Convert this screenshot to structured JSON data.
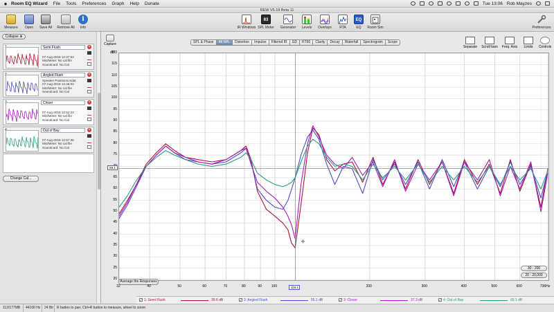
{
  "menubar": {
    "apple": "",
    "app_name": "Room EQ Wizard",
    "items": [
      "File",
      "Tools",
      "Preferences",
      "Graph",
      "Help",
      "Donate"
    ],
    "clock": "Tue 13:06",
    "user": "Rob Mayzes"
  },
  "window": {
    "title": "REW V5.19 Beta 11"
  },
  "toolbar": {
    "left": [
      {
        "label": "Measure",
        "color": "#e8c24a"
      },
      {
        "label": "Open",
        "color": "#6b86c9"
      },
      {
        "label": "Save All",
        "color": "#8a8a8a"
      },
      {
        "label": "Remove All",
        "color": "#c95050"
      },
      {
        "label": "Info",
        "color": "#3a78c9"
      }
    ],
    "center": [
      {
        "label": "IR Windows"
      },
      {
        "label": "SPL Meter",
        "badge": "83"
      },
      {
        "label": "Generator"
      },
      {
        "label": "Levels"
      },
      {
        "label": "Overlays"
      },
      {
        "label": "RTA"
      },
      {
        "label": "EQ"
      },
      {
        "label": "Room Sim"
      }
    ],
    "right": [
      {
        "label": "Preferences"
      }
    ]
  },
  "left_panel": {
    "collapse_label": "Collapse",
    "change_cal_label": "Change Cal...",
    "measurements": [
      {
        "num": "1",
        "name": "Semi Flush",
        "date": "07-Aug-2018 12:37:53",
        "mic": "Mic/Meter: No cal file",
        "soundcard": "Soundcard: No Cal",
        "color": "#b0142b"
      },
      {
        "num": "2",
        "name": "Angled Flush",
        "file": "Speaker Positions.mdat",
        "date": "07-Aug-2018 12:46:03",
        "mic": "Mic/Meter: No cal file",
        "soundcard": "Soundcard: No Cal",
        "color": "#4b4bc4"
      },
      {
        "num": "3",
        "name": "Closer",
        "date": "07-Aug-2018 12:52:23",
        "mic": "Mic/Meter: No cal file",
        "soundcard": "Soundcard: No Cal",
        "color": "#a51ac0"
      },
      {
        "num": "4",
        "name": "Out of Bay",
        "date": "07-Aug-2018 12:57:38",
        "mic": "Mic/Meter: No cal file",
        "soundcard": "Soundcard: No Cal",
        "color": "#2a9a84"
      }
    ]
  },
  "graph_panel": {
    "capture_label": "Capture",
    "tabs": [
      "SPL & Phase",
      "All SPL",
      "Distortion",
      "Impulse",
      "Filtered IR",
      "GD",
      "RT60",
      "Clarity",
      "Decay",
      "Waterfall",
      "Spectrogram",
      "Scope"
    ],
    "active_tab": "All SPL",
    "tools": [
      "Separate",
      "Scroll bars",
      "Freq. Axis",
      "Limits",
      "Controls"
    ],
    "avg_label": "Average the Responses",
    "range_buttons": [
      "30 - 200",
      "20 - 20,000"
    ],
    "cursor_level_label": "69.1",
    "cursor_freq_label": "116.1"
  },
  "chart_data": {
    "type": "line",
    "xscale": "log",
    "xlim": [
      32,
      736
    ],
    "ylim": [
      20,
      120
    ],
    "ylabel": "dB",
    "yticks": [
      120,
      115,
      110,
      105,
      100,
      95,
      90,
      85,
      80,
      75,
      70,
      65,
      60,
      55,
      50,
      45,
      40,
      35,
      30,
      25,
      20
    ],
    "xticks": [
      {
        "value": 32,
        "label": "32"
      },
      {
        "value": 40,
        "label": "40"
      },
      {
        "value": 50,
        "label": "50"
      },
      {
        "value": 60,
        "label": "60"
      },
      {
        "value": 70,
        "label": "70"
      },
      {
        "value": 80,
        "label": "80"
      },
      {
        "value": 90,
        "label": "90"
      },
      {
        "value": 100,
        "label": "100"
      },
      {
        "value": 200,
        "label": "200"
      },
      {
        "value": 300,
        "label": "300"
      },
      {
        "value": 400,
        "label": "400"
      },
      {
        "value": 500,
        "label": "500"
      },
      {
        "value": 600,
        "label": "600"
      },
      {
        "value": 736,
        "label": "736Hz"
      }
    ],
    "grid": true,
    "cursor": {
      "x": 116.1,
      "y": 69.1
    },
    "series": [
      {
        "name": "1: Semi Flush",
        "color": "#a8143a",
        "value_label": "39.6 dB",
        "x": [
          32,
          34,
          36,
          39,
          42,
          45,
          48,
          52,
          57,
          63,
          70,
          78,
          81,
          84,
          88,
          94,
          100,
          106,
          110,
          113,
          116,
          121,
          127,
          132,
          138,
          146,
          155,
          165,
          176,
          190,
          205,
          220,
          240,
          260,
          285,
          310,
          340,
          370,
          400,
          440,
          480,
          520,
          560,
          600,
          650,
          700,
          736
        ],
        "y": [
          49,
          55,
          61,
          71,
          76,
          80,
          77,
          74,
          73,
          72,
          73,
          77,
          79,
          73,
          59,
          51,
          48,
          45,
          42,
          36,
          34,
          53,
          76,
          87,
          84,
          73,
          68,
          71,
          72,
          63,
          74,
          62,
          72,
          60,
          73,
          62,
          72,
          58,
          73,
          62,
          71,
          58,
          73,
          59,
          71,
          52,
          69
        ]
      },
      {
        "name": "2: Angled Flush",
        "color": "#4b4bc4",
        "value_label": "55.1 dB",
        "x": [
          32,
          34,
          36,
          39,
          42,
          45,
          48,
          52,
          57,
          63,
          70,
          78,
          81,
          84,
          88,
          94,
          100,
          106,
          110,
          113,
          116,
          121,
          127,
          132,
          138,
          146,
          155,
          165,
          176,
          190,
          205,
          220,
          240,
          260,
          285,
          310,
          340,
          370,
          400,
          440,
          480,
          520,
          560,
          600,
          650,
          700,
          736
        ],
        "y": [
          47,
          53,
          60,
          70,
          75,
          79,
          76,
          73,
          72,
          71,
          72,
          76,
          78,
          72,
          60,
          55,
          52,
          51,
          55,
          60,
          65,
          75,
          83,
          86,
          82,
          71,
          62,
          70,
          69,
          58,
          73,
          64,
          71,
          62,
          72,
          60,
          73,
          61,
          72,
          60,
          70,
          61,
          72,
          62,
          70,
          56,
          68
        ]
      },
      {
        "name": "3: Closer",
        "color": "#a51ac0",
        "value_label": "37.3 dB",
        "x": [
          32,
          34,
          36,
          39,
          42,
          45,
          48,
          52,
          57,
          63,
          70,
          78,
          81,
          84,
          88,
          94,
          100,
          106,
          110,
          113,
          116,
          121,
          127,
          132,
          138,
          146,
          155,
          165,
          176,
          190,
          205,
          220,
          240,
          260,
          285,
          310,
          340,
          370,
          400,
          440,
          480,
          520,
          560,
          600,
          650,
          700,
          736
        ],
        "y": [
          48,
          54,
          61,
          70,
          75,
          79,
          76,
          74,
          72,
          71,
          73,
          77,
          78,
          71,
          63,
          59,
          56,
          52,
          48,
          44,
          38,
          62,
          80,
          88,
          83,
          75,
          71,
          69,
          74,
          66,
          72,
          61,
          73,
          59,
          71,
          64,
          72,
          57,
          72,
          64,
          73,
          57,
          70,
          60,
          72,
          50,
          67
        ]
      },
      {
        "name": "4: Out of Bay",
        "color": "#2a9a84",
        "value_label": "69.1 dB",
        "x": [
          32,
          34,
          36,
          39,
          42,
          45,
          48,
          52,
          57,
          63,
          70,
          78,
          81,
          84,
          88,
          94,
          100,
          106,
          110,
          113,
          116,
          121,
          127,
          132,
          138,
          146,
          155,
          165,
          176,
          190,
          205,
          220,
          240,
          260,
          285,
          310,
          340,
          370,
          400,
          440,
          480,
          520,
          560,
          600,
          650,
          700,
          736
        ],
        "y": [
          52,
          57,
          63,
          70,
          74,
          77,
          75,
          73,
          71,
          70,
          71,
          74,
          76,
          73,
          67,
          64,
          62,
          61,
          62,
          63,
          65,
          72,
          79,
          82,
          80,
          74,
          70,
          71,
          70,
          64,
          71,
          65,
          70,
          64,
          71,
          63,
          70,
          64,
          70,
          63,
          70,
          62,
          70,
          64,
          69,
          60,
          68
        ]
      }
    ]
  },
  "statusbar": {
    "memory": "112/177MB",
    "sample_rate": "44100 Hz",
    "bits": "24 Bit",
    "hint": "R button to pan; Ctrl+R button to measure, wheel to zoom"
  }
}
